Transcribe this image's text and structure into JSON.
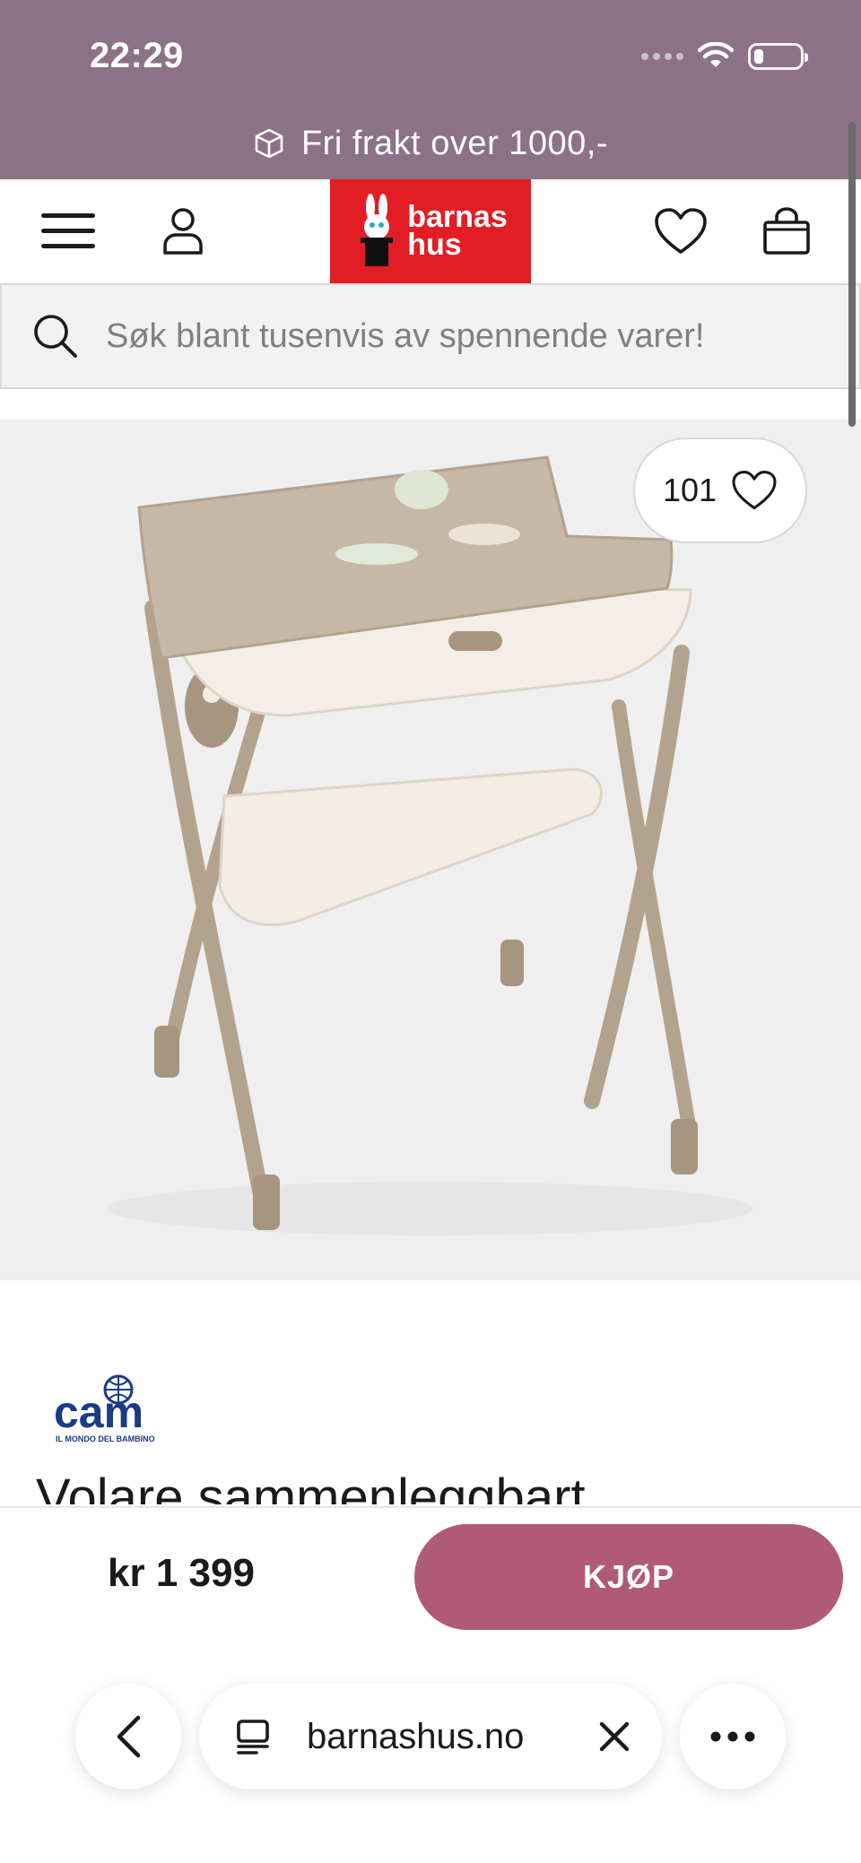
{
  "status_bar": {
    "time": "22:29",
    "icons": [
      "signal-dots-icon",
      "wifi-icon",
      "battery-icon"
    ]
  },
  "promo": {
    "icon": "package-icon",
    "text": "Fri frakt over 1000,-"
  },
  "header": {
    "logo_line1": "barnas",
    "logo_line2": "hus",
    "icons": [
      "menu-icon",
      "account-icon",
      "heart-icon",
      "shopping-bag-icon"
    ]
  },
  "search": {
    "placeholder": "Søk blant tusenvis av spennende varer!",
    "value": ""
  },
  "product": {
    "favorites_count": "101",
    "brand_name": "cam",
    "brand_tagline": "IL MONDO DEL BAMBINO",
    "title": "Volare sammenleggbart"
  },
  "buy_bar": {
    "price": "kr 1 399",
    "buy_label": "KJØP"
  },
  "browser": {
    "url": "barnashus.no"
  },
  "colors": {
    "promo_bg": "#8c7287",
    "logo_red": "#e21e24",
    "buy_button": "#b05a78"
  }
}
